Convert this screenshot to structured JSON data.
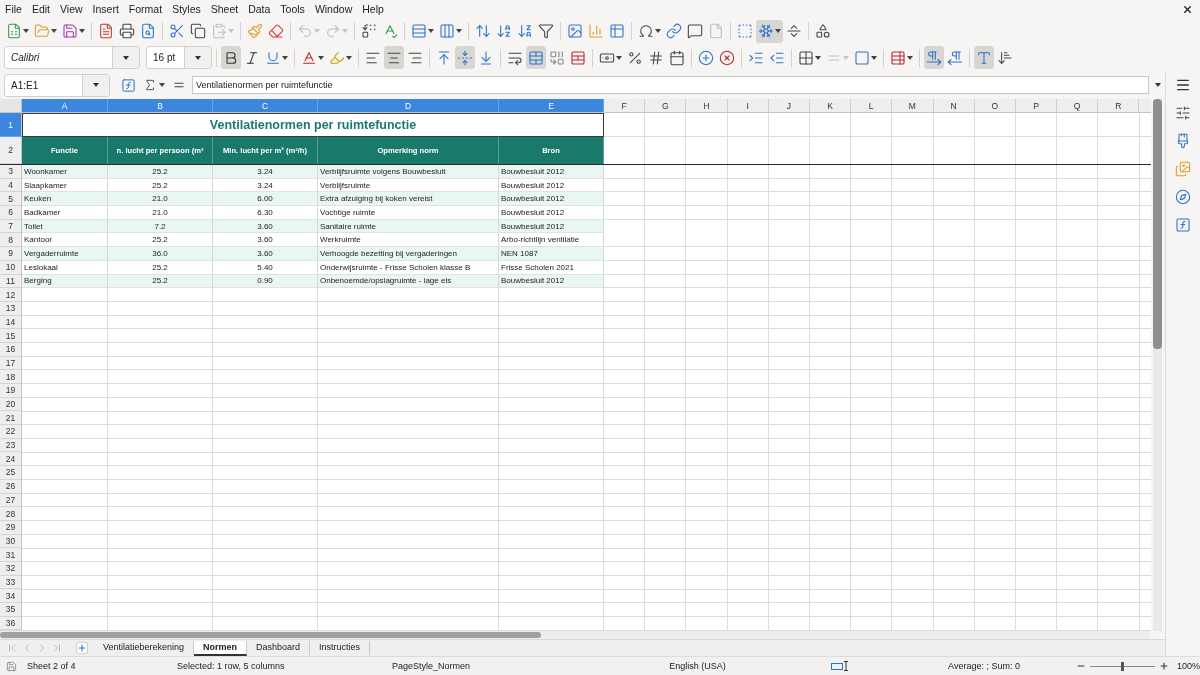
{
  "menu_bar": [
    "File",
    "Edit",
    "View",
    "Insert",
    "Format",
    "Styles",
    "Sheet",
    "Data",
    "Tools",
    "Window",
    "Help"
  ],
  "standard_toolbar": [
    {
      "kind": "new",
      "on": false,
      "disabled": false
    },
    {
      "kind": "open",
      "on": false,
      "disabled": false
    },
    {
      "kind": "save",
      "on": false,
      "disabled": false
    },
    {
      "kind": "separator"
    },
    {
      "kind": "pdf",
      "on": false,
      "disabled": false
    },
    {
      "kind": "print",
      "on": false,
      "disabled": false
    },
    {
      "kind": "preview",
      "on": false,
      "disabled": false
    },
    {
      "kind": "separator"
    },
    {
      "kind": "cut",
      "on": false,
      "disabled": false
    },
    {
      "kind": "copy",
      "on": false,
      "disabled": false
    },
    {
      "kind": "paste",
      "on": false,
      "disabled": true
    },
    {
      "kind": "separator"
    },
    {
      "kind": "clone",
      "on": false,
      "disabled": false
    },
    {
      "kind": "clear",
      "on": false,
      "disabled": false
    },
    {
      "kind": "separator"
    },
    {
      "kind": "undo",
      "on": false,
      "disabled": true
    },
    {
      "kind": "redo",
      "on": false,
      "disabled": true
    },
    {
      "kind": "separator"
    },
    {
      "kind": "find",
      "on": false,
      "disabled": false
    },
    {
      "kind": "spelling",
      "on": false,
      "disabled": false
    },
    {
      "kind": "separator"
    },
    {
      "kind": "row",
      "on": false,
      "disabled": false
    },
    {
      "kind": "column",
      "on": false,
      "disabled": false
    },
    {
      "kind": "separator"
    },
    {
      "kind": "sort",
      "on": false,
      "disabled": false
    },
    {
      "kind": "ascending",
      "on": false,
      "disabled": false
    },
    {
      "kind": "descending",
      "on": false,
      "disabled": false
    },
    {
      "kind": "autofilter",
      "on": false,
      "disabled": false
    },
    {
      "kind": "separator"
    },
    {
      "kind": "image",
      "on": false,
      "disabled": false
    },
    {
      "kind": "chart",
      "on": false,
      "disabled": false
    },
    {
      "kind": "pivot",
      "on": false,
      "disabled": false
    },
    {
      "kind": "separator"
    },
    {
      "kind": "symbol",
      "on": false,
      "disabled": false
    },
    {
      "kind": "hyperlink",
      "on": false,
      "disabled": false
    },
    {
      "kind": "comment",
      "on": false,
      "disabled": false
    },
    {
      "kind": "headerfooter",
      "on": false,
      "disabled": true
    },
    {
      "kind": "separator"
    },
    {
      "kind": "printarea",
      "on": false,
      "disabled": false
    },
    {
      "kind": "freeze",
      "on": true,
      "disabled": false
    },
    {
      "kind": "split",
      "on": false,
      "disabled": false
    },
    {
      "kind": "separator"
    },
    {
      "kind": "draw",
      "on": false,
      "disabled": false
    }
  ],
  "formatting_toolbar": {
    "font_name": "Calibri",
    "font_size": "16 pt",
    "buttons": [
      {
        "kind": "separator"
      },
      {
        "kind": "bold",
        "on": true,
        "disabled": false
      },
      {
        "kind": "italic",
        "on": false,
        "disabled": false
      },
      {
        "kind": "underline",
        "on": false,
        "disabled": false
      },
      {
        "kind": "separator"
      },
      {
        "kind": "fontcolor",
        "on": false,
        "disabled": false
      },
      {
        "kind": "highlight",
        "on": false,
        "disabled": false
      },
      {
        "kind": "separator"
      },
      {
        "kind": "left",
        "on": false,
        "disabled": false
      },
      {
        "kind": "center",
        "on": true,
        "disabled": false
      },
      {
        "kind": "right",
        "on": false,
        "disabled": false
      },
      {
        "kind": "separator"
      },
      {
        "kind": "top",
        "on": false,
        "disabled": false
      },
      {
        "kind": "middle",
        "on": true,
        "disabled": false
      },
      {
        "kind": "bottom",
        "on": false,
        "disabled": false
      },
      {
        "kind": "separator"
      },
      {
        "kind": "wrap",
        "on": false,
        "disabled": false
      },
      {
        "kind": "mergecenter",
        "on": true,
        "disabled": false
      },
      {
        "kind": "merge",
        "on": false,
        "disabled": false
      },
      {
        "kind": "unmerge",
        "on": false,
        "disabled": false
      },
      {
        "kind": "separator"
      },
      {
        "kind": "currency",
        "on": false,
        "disabled": false
      },
      {
        "kind": "percent",
        "on": false,
        "disabled": false
      },
      {
        "kind": "number",
        "on": false,
        "disabled": false
      },
      {
        "kind": "date",
        "on": false,
        "disabled": false
      },
      {
        "kind": "separator"
      },
      {
        "kind": "adddecimal",
        "on": false,
        "disabled": false
      },
      {
        "kind": "deldecimal",
        "on": false,
        "disabled": false
      },
      {
        "kind": "separator"
      },
      {
        "kind": "indent",
        "on": false,
        "disabled": false
      },
      {
        "kind": "outdent",
        "on": false,
        "disabled": false
      },
      {
        "kind": "separator"
      },
      {
        "kind": "borders",
        "on": false,
        "disabled": false
      },
      {
        "kind": "borderstyle",
        "on": false,
        "disabled": true
      },
      {
        "kind": "bordercolor",
        "on": false,
        "disabled": false
      },
      {
        "kind": "separator"
      },
      {
        "kind": "conditional",
        "on": false,
        "disabled": false
      },
      {
        "kind": "separator"
      },
      {
        "kind": "ltr",
        "on": true,
        "disabled": false
      },
      {
        "kind": "rtl",
        "on": false,
        "disabled": false
      },
      {
        "kind": "separator"
      },
      {
        "kind": "horizontal",
        "on": true,
        "disabled": false
      },
      {
        "kind": "vertical",
        "on": false,
        "disabled": false
      }
    ]
  },
  "formula_bar": {
    "name_box": "A1:E1",
    "content": "Ventilatienormen per ruimtefunctie"
  },
  "sheet": {
    "columns": [
      {
        "label": "A",
        "selected": true
      },
      {
        "label": "B",
        "selected": true
      },
      {
        "label": "C",
        "selected": true
      },
      {
        "label": "D",
        "selected": true
      },
      {
        "label": "E",
        "selected": true
      },
      {
        "label": "F",
        "selected": false
      },
      {
        "label": "G",
        "selected": false
      },
      {
        "label": "H",
        "selected": false
      },
      {
        "label": "I",
        "selected": false
      },
      {
        "label": "J",
        "selected": false
      },
      {
        "label": "K",
        "selected": false
      },
      {
        "label": "L",
        "selected": false
      },
      {
        "label": "M",
        "selected": false
      },
      {
        "label": "N",
        "selected": false
      },
      {
        "label": "O",
        "selected": false
      },
      {
        "label": "P",
        "selected": false
      },
      {
        "label": "Q",
        "selected": false
      },
      {
        "label": "R",
        "selected": false
      }
    ],
    "rows": [
      {
        "label": "1",
        "selected": true,
        "kind": "title",
        "text": "Ventilatienormen per ruimtefunctie"
      },
      {
        "label": "2",
        "selected": false,
        "kind": "header",
        "cells": [
          "Functie",
          "n. lucht per persoon (m³",
          "Min. lucht per m² (m³/h)",
          "Opmerking norm",
          "Bron"
        ]
      },
      {
        "label": "3",
        "selected": false,
        "kind": "data",
        "cells": [
          "Woonkamer",
          "25.2",
          "3.24",
          "Verblijfsruimte volgens Bouwbesluit",
          "Bouwbesluit 2012"
        ]
      },
      {
        "label": "4",
        "selected": false,
        "kind": "data",
        "cells": [
          "Slaapkamer",
          "25.2",
          "3.24",
          "Verblijfsruimte",
          "Bouwbesluit 2012"
        ]
      },
      {
        "label": "5",
        "selected": false,
        "kind": "data",
        "cells": [
          "Keuken",
          "21.0",
          "6.00",
          "Extra afzuiging bij koken vereist",
          "Bouwbesluit 2012"
        ]
      },
      {
        "label": "6",
        "selected": false,
        "kind": "data",
        "cells": [
          "Badkamer",
          "21.0",
          "6.30",
          "Vochtige ruimte",
          "Bouwbesluit 2012"
        ]
      },
      {
        "label": "7",
        "selected": false,
        "kind": "data",
        "cells": [
          "Toilet",
          "7.2",
          "3.60",
          "Sanitaire ruimte",
          "Bouwbesluit 2012"
        ]
      },
      {
        "label": "8",
        "selected": false,
        "kind": "data",
        "cells": [
          "Kantoor",
          "25.2",
          "3.60",
          "Werkruimte",
          "Arbo-richtlijn ventilatie"
        ]
      },
      {
        "label": "9",
        "selected": false,
        "kind": "data",
        "cells": [
          "Vergaderruimte",
          "36.0",
          "3.60",
          "Verhoogde bezetting bij vergaderingen",
          "NEN 1087"
        ]
      },
      {
        "label": "10",
        "selected": false,
        "kind": "data",
        "cells": [
          "Leslokaal",
          "25.2",
          "5.40",
          "Onderwijsruimte - Frisse Scholen klasse B",
          "Frisse Scholen 2021"
        ]
      },
      {
        "label": "11",
        "selected": false,
        "kind": "data",
        "cells": [
          "Berging",
          "25.2",
          "0.90",
          "Onbenoemde/opslagruimte - lage eis",
          "Bouwbesluit 2012"
        ]
      },
      {
        "label": "12",
        "selected": false,
        "kind": "empty"
      },
      {
        "label": "13",
        "selected": false,
        "kind": "empty"
      },
      {
        "label": "14",
        "selected": false,
        "kind": "empty"
      },
      {
        "label": "15",
        "selected": false,
        "kind": "empty"
      },
      {
        "label": "16",
        "selected": false,
        "kind": "empty"
      },
      {
        "label": "17",
        "selected": false,
        "kind": "empty"
      },
      {
        "label": "18",
        "selected": false,
        "kind": "empty"
      },
      {
        "label": "19",
        "selected": false,
        "kind": "empty"
      },
      {
        "label": "20",
        "selected": false,
        "kind": "empty"
      },
      {
        "label": "21",
        "selected": false,
        "kind": "empty"
      },
      {
        "label": "22",
        "selected": false,
        "kind": "empty"
      },
      {
        "label": "23",
        "selected": false,
        "kind": "empty"
      },
      {
        "label": "24",
        "selected": false,
        "kind": "empty"
      },
      {
        "label": "25",
        "selected": false,
        "kind": "empty"
      },
      {
        "label": "26",
        "selected": false,
        "kind": "empty"
      },
      {
        "label": "27",
        "selected": false,
        "kind": "empty"
      },
      {
        "label": "28",
        "selected": false,
        "kind": "empty"
      },
      {
        "label": "29",
        "selected": false,
        "kind": "empty"
      },
      {
        "label": "30",
        "selected": false,
        "kind": "empty"
      },
      {
        "label": "31",
        "selected": false,
        "kind": "empty"
      },
      {
        "label": "32",
        "selected": false,
        "kind": "empty"
      },
      {
        "label": "33",
        "selected": false,
        "kind": "empty"
      },
      {
        "label": "34",
        "selected": false,
        "kind": "empty"
      },
      {
        "label": "35",
        "selected": false,
        "kind": "empty"
      },
      {
        "label": "36",
        "selected": false,
        "kind": "empty"
      }
    ]
  },
  "sheet_tabs": [
    {
      "label": "Ventilatieberekening",
      "selected": false
    },
    {
      "label": "Normen",
      "selected": true
    },
    {
      "label": "Dashboard",
      "selected": false
    },
    {
      "label": "Instructies",
      "selected": false
    }
  ],
  "status_bar": {
    "sheet": "Sheet 2 of 4",
    "selection": "Selected: 1 row, 5 columns",
    "page_style": "PageStyle_Normen",
    "language": "English (USA)",
    "summary": "Average: ; Sum: 0",
    "zoom": {
      "level": 0.5,
      "reading": "100%"
    }
  }
}
